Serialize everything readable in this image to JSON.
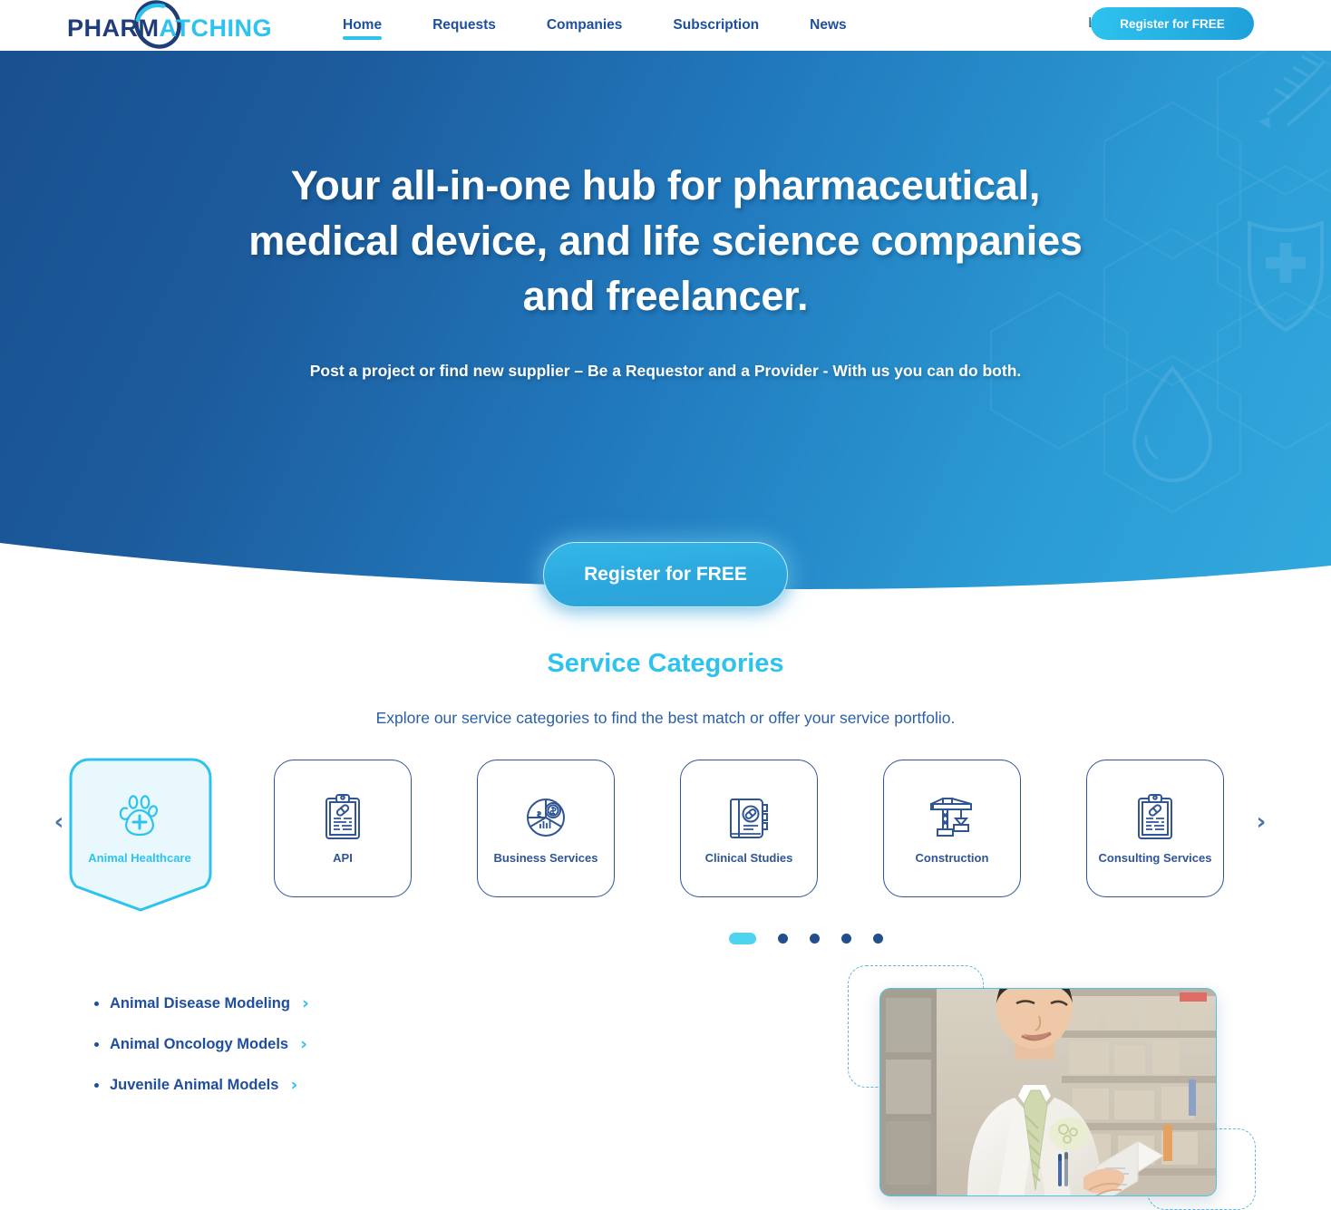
{
  "header": {
    "logo": {
      "part1": "PHARM",
      "part2": "ATCHING",
      "icon": "ring-swoosh-icon"
    },
    "nav": [
      {
        "label": "Home",
        "active": true
      },
      {
        "label": "Requests",
        "active": false
      },
      {
        "label": "Companies",
        "active": false
      },
      {
        "label": "Subscription",
        "active": false
      },
      {
        "label": "News",
        "active": false
      }
    ],
    "login_label": "Login",
    "register_label": "Register for FREE"
  },
  "hero": {
    "heading": "Your all-in-one hub for pharmaceutical, medical device, and life science companies and freelancer.",
    "subheading": "Post a project or find new supplier – Be a Requestor and a Provider - With us you can do both.",
    "cta_label": "Register for FREE",
    "gradient_start": "#19508f",
    "gradient_end": "#31a9dd",
    "decorations": [
      "hexagon-pattern",
      "shield-cross-icon",
      "water-drop-icon",
      "dna-helix-icon"
    ]
  },
  "services": {
    "title": "Service Categories",
    "subtitle": "Explore our service categories to find the best match or offer your service portfolio.",
    "accent_color": "#2ec3ef",
    "card_color": "#2f5596",
    "prev_label": "‹",
    "next_label": "›",
    "cards": [
      {
        "label": "Animal Healthcare",
        "icon": "paw-cross-icon",
        "active": true
      },
      {
        "label": "API",
        "icon": "clipboard-pill-icon",
        "active": false
      },
      {
        "label": "Business Services",
        "icon": "pie-chart-dollar-icon",
        "active": false
      },
      {
        "label": "Clinical Studies",
        "icon": "book-pill-icon",
        "active": false
      },
      {
        "label": "Construction",
        "icon": "crane-icon",
        "active": false
      },
      {
        "label": "Consulting Services",
        "icon": "clipboard-pill-icon",
        "active": false
      }
    ],
    "dots": [
      {
        "active": true
      },
      {
        "active": false
      },
      {
        "active": false
      },
      {
        "active": false
      },
      {
        "active": false
      }
    ],
    "subcategories": [
      {
        "label": "Animal Disease Modeling"
      },
      {
        "label": "Animal Oncology Models"
      },
      {
        "label": "Juvenile Animal Models"
      }
    ]
  },
  "photo": {
    "alt": "pharmacist-holding-medicine-box",
    "border_color": "#4fc0e6"
  }
}
